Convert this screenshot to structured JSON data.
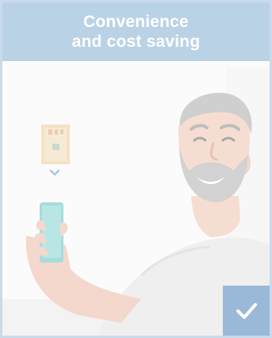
{
  "card": {
    "title_line1": "Convenience",
    "title_line2": "and cost saving",
    "selected": true
  },
  "icons": {
    "card_illustration": "person-holding-phone-illustration",
    "selected_indicator": "checkmark-icon"
  },
  "colors": {
    "header_background": "#bad2e6",
    "border": "#c9daea",
    "check_background": "#9ab8d8",
    "header_text": "#ffffff"
  }
}
